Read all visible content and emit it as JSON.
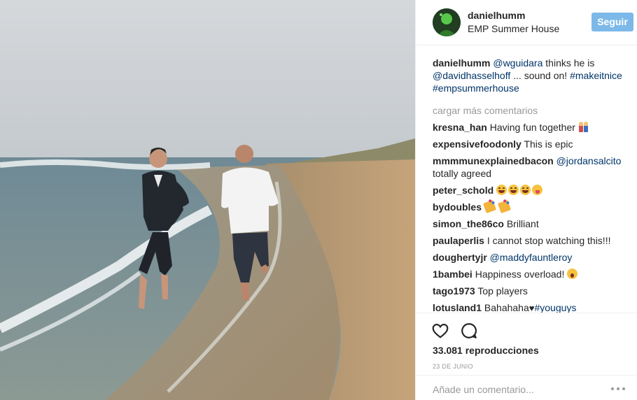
{
  "post": {
    "owner": "danielhumm",
    "location": "EMP Summer House",
    "follow_label": "Seguir",
    "caption": {
      "user": "danielhumm",
      "mention1": "@wguidara",
      "text1": " thinks he is ",
      "mention2": "@davidhasselhoff",
      "text2": " ... sound on! ",
      "tag1": "#makeitnice",
      "tag2": "#empsummerhouse"
    },
    "load_more": "cargar más comentarios",
    "comments": [
      {
        "user": "kresna_han",
        "text": "Having fun together",
        "emoji": "couple"
      },
      {
        "user": "expensivefoodonly",
        "text": "This is epic"
      },
      {
        "user": "mmmmunexplainedbacon",
        "mention": "@jordansalcito",
        "text": "totally agreed"
      },
      {
        "user": "peter_schold",
        "text": "",
        "emoji": "laugh laugh laugh tongue"
      },
      {
        "user": "bydoubles",
        "text": "",
        "emoji": "party party"
      },
      {
        "user": "simon_the86co",
        "text": "Brilliant"
      },
      {
        "user": "paulaperlis",
        "text": "I cannot stop watching this!!!"
      },
      {
        "user": "doughertyjr",
        "mention": "@maddyfauntleroy",
        "text": ""
      },
      {
        "user": "1bambei",
        "text": "Happiness overload!",
        "emoji": "wow"
      },
      {
        "user": "tago1973",
        "text": "Top players"
      },
      {
        "user": "lotusland1",
        "text": "Bahahaha",
        "heart": "♥",
        "tag": "#youguys"
      }
    ],
    "views": "33.081 reproducciones",
    "date": "23 DE JUNIO",
    "add_comment_placeholder": "Añade un comentario...",
    "icons": {
      "like": "heart-outline-icon",
      "comment": "speech-bubble-icon",
      "more": "more-options-icon"
    },
    "colors": {
      "follow_button": "#7db9e8",
      "link": "#003569",
      "muted": "#999999"
    }
  }
}
